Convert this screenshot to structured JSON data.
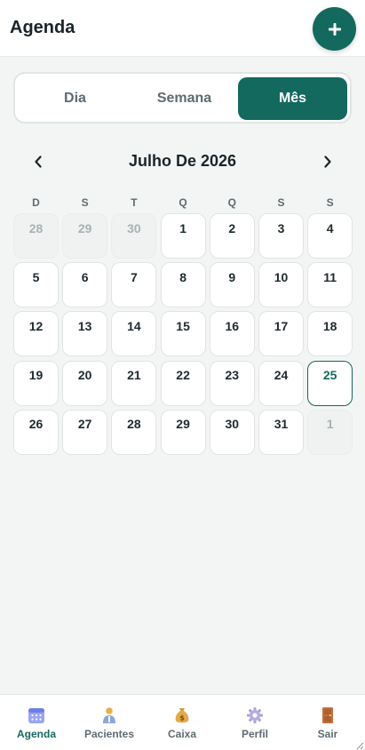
{
  "header": {
    "title": "Agenda",
    "add_icon": "plus-icon",
    "add_color": "#13695e"
  },
  "view_switch": {
    "day": "Dia",
    "week": "Semana",
    "month": "Mês",
    "selected": "Mês"
  },
  "calendar": {
    "month_label": "Julho De 2026",
    "prev_icon": "chevron-left-icon",
    "next_icon": "chevron-right-icon",
    "weekdays": [
      "D",
      "S",
      "T",
      "Q",
      "Q",
      "S",
      "S"
    ],
    "days": [
      {
        "label": "28",
        "muted": true
      },
      {
        "label": "29",
        "muted": true
      },
      {
        "label": "30",
        "muted": true
      },
      {
        "label": "1"
      },
      {
        "label": "2"
      },
      {
        "label": "3"
      },
      {
        "label": "4"
      },
      {
        "label": "5"
      },
      {
        "label": "6"
      },
      {
        "label": "7"
      },
      {
        "label": "8"
      },
      {
        "label": "9"
      },
      {
        "label": "10"
      },
      {
        "label": "11"
      },
      {
        "label": "12"
      },
      {
        "label": "13"
      },
      {
        "label": "14"
      },
      {
        "label": "15"
      },
      {
        "label": "16"
      },
      {
        "label": "17"
      },
      {
        "label": "18"
      },
      {
        "label": "19"
      },
      {
        "label": "20"
      },
      {
        "label": "21"
      },
      {
        "label": "22"
      },
      {
        "label": "23"
      },
      {
        "label": "24"
      },
      {
        "label": "25",
        "today": true
      },
      {
        "label": "26"
      },
      {
        "label": "27"
      },
      {
        "label": "28"
      },
      {
        "label": "29"
      },
      {
        "label": "30"
      },
      {
        "label": "31"
      },
      {
        "label": "1",
        "muted": true
      }
    ],
    "today": "25"
  },
  "bottom_nav": {
    "items": [
      {
        "label": "Agenda",
        "icon": "calendar-icon",
        "active": true
      },
      {
        "label": "Pacientes",
        "icon": "patient-icon"
      },
      {
        "label": "Caixa",
        "icon": "money-bag-icon"
      },
      {
        "label": "Perfil",
        "icon": "gear-icon"
      },
      {
        "label": "Sair",
        "icon": "door-icon"
      }
    ]
  },
  "colors": {
    "accent": "#13695e",
    "background": "#f3f5f4"
  }
}
